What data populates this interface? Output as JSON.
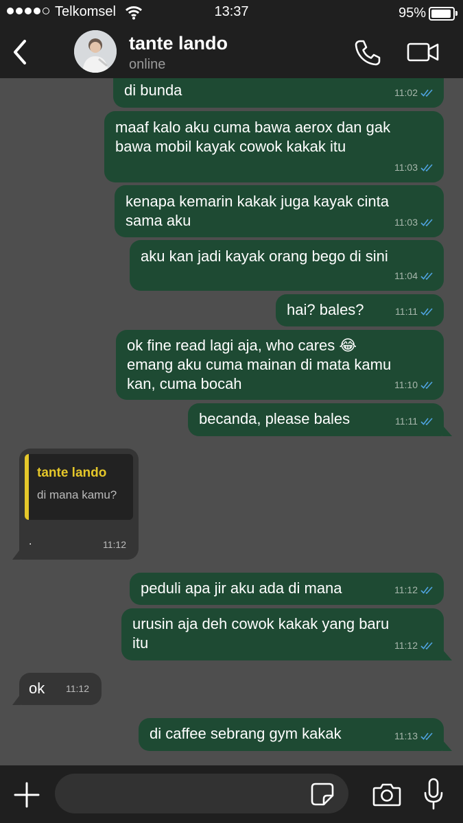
{
  "status_bar": {
    "carrier": "Telkomsel",
    "time": "13:37",
    "battery": "95%",
    "battery_level": 0.95,
    "signal_bars": 4,
    "signal_max": 5
  },
  "header": {
    "contact_name": "tante lando",
    "status": "online",
    "back_icon": "chevron-left-icon",
    "call_icon": "phone-icon",
    "video_icon": "video-camera-icon"
  },
  "messages": [
    {
      "dir": "out",
      "lines": [
        "di bunda"
      ],
      "time": "11:02",
      "read": true
    },
    {
      "dir": "out",
      "lines": [
        "maaf kalo aku cuma bawa aerox dan gak",
        "bawa mobil kayak cowok kakak itu"
      ],
      "time": "11:03",
      "read": true
    },
    {
      "dir": "out",
      "lines": [
        "kenapa kemarin kakak juga kayak cinta",
        "sama aku"
      ],
      "time": "11:03",
      "read": true
    },
    {
      "dir": "out",
      "lines": [
        "aku kan jadi kayak orang bego di sini"
      ],
      "time": "11:04",
      "read": true
    },
    {
      "dir": "out",
      "lines": [
        "hai? bales?"
      ],
      "time": "11:11",
      "read": true
    },
    {
      "dir": "out",
      "lines": [
        "ok fine read lagi aja, who cares 😂",
        "emang aku cuma mainan di mata kamu",
        "kan, cuma bocah"
      ],
      "time": "11:10",
      "read": true
    },
    {
      "dir": "out",
      "lines": [
        "becanda, please bales"
      ],
      "time": "11:11",
      "read": true
    },
    {
      "dir": "in",
      "quote_name": "tante lando",
      "quote_text": "di mana kamu?",
      "lines": [
        "."
      ],
      "time": "11:12"
    },
    {
      "dir": "out",
      "lines": [
        "peduli apa jir aku ada di mana"
      ],
      "time": "11:12",
      "read": true
    },
    {
      "dir": "out",
      "lines": [
        "urusin aja deh cowok kakak yang baru",
        "itu"
      ],
      "time": "11:12",
      "read": true
    },
    {
      "dir": "in",
      "lines": [
        "ok"
      ],
      "time": "11:12"
    },
    {
      "dir": "out",
      "lines": [
        "di caffee sebrang gym kakak"
      ],
      "time": "11:13",
      "read": true
    }
  ],
  "input_bar": {
    "placeholder": "",
    "plus_icon": "plus-icon",
    "sticker_icon": "sticker-icon",
    "camera_icon": "camera-icon",
    "mic_icon": "microphone-icon"
  },
  "colors": {
    "outgoing_bubble": "#1e4a33",
    "incoming_bubble": "#353535",
    "chat_background": "#4e4e4e",
    "bars": "#1f1f1f",
    "quote_accent": "#e5c72a",
    "read_ticks": "#4fa3e0"
  }
}
